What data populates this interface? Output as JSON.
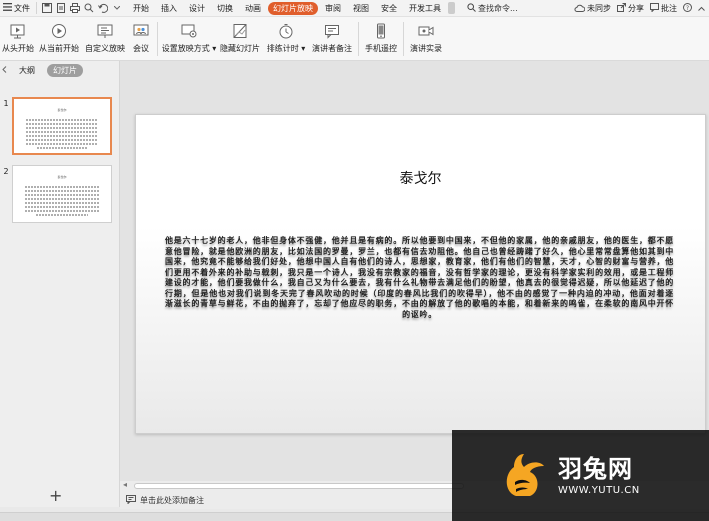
{
  "menubar": {
    "file_label": "文件",
    "tabs": [
      {
        "label": "开始"
      },
      {
        "label": "插入"
      },
      {
        "label": "设计"
      },
      {
        "label": "切换"
      },
      {
        "label": "动画"
      },
      {
        "label": "幻灯片放映",
        "active": true
      },
      {
        "label": "审阅"
      },
      {
        "label": "视图"
      },
      {
        "label": "安全"
      },
      {
        "label": "开发工具"
      }
    ],
    "search_label": "查找命令...",
    "sync_label": "未同步",
    "share_label": "分享",
    "comment_label": "批注"
  },
  "ribbon": {
    "groups": [
      [
        {
          "label": "从头开始",
          "icon": "play-from-start-icon"
        },
        {
          "label": "从当前开始",
          "icon": "play-from-current-icon"
        },
        {
          "label": "自定义放映",
          "icon": "custom-show-icon"
        },
        {
          "label": "会议",
          "icon": "meeting-icon"
        }
      ],
      [
        {
          "label": "设置放映方式",
          "icon": "setup-show-icon",
          "dropdown": true
        },
        {
          "label": "隐藏幻灯片",
          "icon": "hide-slide-icon"
        },
        {
          "label": "排练计时",
          "icon": "rehearse-timing-icon",
          "dropdown": true
        },
        {
          "label": "演讲者备注",
          "icon": "speaker-notes-icon"
        }
      ],
      [
        {
          "label": "手机遥控",
          "icon": "phone-remote-icon"
        }
      ],
      [
        {
          "label": "演讲实录",
          "icon": "record-icon"
        }
      ]
    ]
  },
  "left_pane": {
    "tabs": [
      {
        "label": "大纲"
      },
      {
        "label": "幻灯片",
        "active": true
      }
    ],
    "slides": [
      {
        "number": "1",
        "title": "泰戈尔",
        "selected": true
      },
      {
        "number": "2",
        "title": "泰戈尔",
        "selected": false
      }
    ],
    "add_label": "+"
  },
  "slide": {
    "title": "泰戈尔",
    "body": "他是六十七岁的老人，他非但身体不强健，他并且是有病的。所以他要到中国来，不但他的家属，他的亲戚朋友，他的医生，都不愿意他冒险，就是他欧洲的朋友，比如法国的罗曼，罗兰，也都有信去劝阻他。他自己也曾经踌躇了好久，他心里常常盘算他如其到中国来，他究竟不能够给我们好处，他想中国人自有他们的诗人，思想家，教育家，他们有他们的智慧，天才，心智的财富与营养，他们更用不着外来的补助与戟刺，我只是一个诗人，我没有宗教家的福音，没有哲学家的理论，更没有科学家实利的效用，或是工程师建设的才能，他们要我做什么，我自己又为什么要去，我有什么礼物带去满足他们的盼望，他真去的很觉得迟疑，所以他延迟了他的行期，但是他也对我们说到冬天完了春风吹动的时候（印度的春风比我们的吹得早），他不由的感觉了一种内迫的冲动，他面对着逐渐滋长的青草与鲜花，不由的抛弃了，忘却了他应尽的职务，不由的解放了他的歌唱的本能，和着新来的鸣雀，在柔软的南风中开怀的讴吟。"
  },
  "notes": {
    "placeholder": "单击此处添加备注"
  },
  "watermark": {
    "name": "羽兔网",
    "url": "WWW.YUTU.CN",
    "color": "#f5a623"
  }
}
